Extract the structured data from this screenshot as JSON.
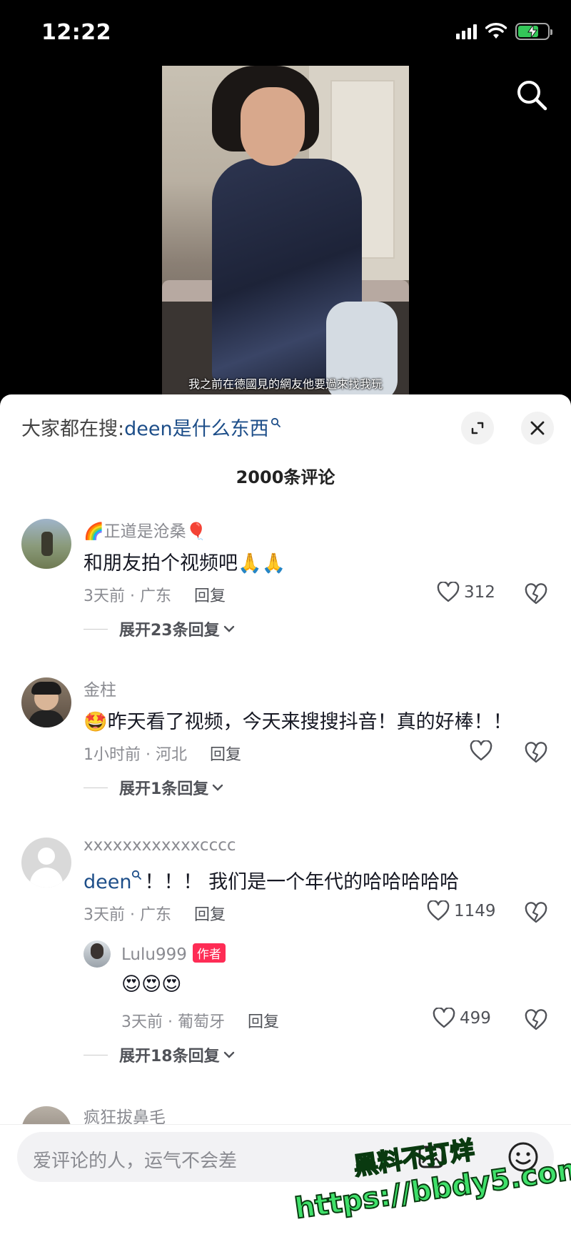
{
  "status": {
    "time": "12:22"
  },
  "video": {
    "subtitle": "我之前在德國見的網友他要過來找我玩"
  },
  "sheet": {
    "hot_search_prefix": "大家都在搜:",
    "hot_search_keyword": "deen是什么东西",
    "comment_count": "2000条评论"
  },
  "comments": [
    {
      "username": "🌈正道是沧桑🎈",
      "text": "和朋友拍个视频吧🙏🙏",
      "meta": "3天前 · 广东",
      "reply": "回复",
      "likes": "312",
      "expand": "展开23条回复"
    },
    {
      "username": "金柱",
      "text": "🤩昨天看了视频，今天来搜搜抖音！真的好棒！！",
      "meta": "1小时前 · 河北",
      "reply": "回复",
      "likes": "",
      "expand": "展开1条回复"
    },
    {
      "username": "xxxxxxxxxxxxcccc",
      "mention": "deen",
      "text": "！！！ 我们是一个年代的哈哈哈哈哈",
      "meta": "3天前 · 广东",
      "reply": "回复",
      "likes": "1149",
      "sub_reply": {
        "username": "Lulu999",
        "badge": "作者",
        "text": "😍😍😍",
        "meta": "3天前 · 葡萄牙",
        "reply": "回复",
        "likes": "499"
      },
      "expand": "展开18条回复"
    },
    {
      "username": "疯狂拔鼻毛"
    }
  ],
  "input": {
    "placeholder": "爱评论的人，运气不会差"
  },
  "watermark": {
    "line1": "黑料不打烊",
    "line2": "https://bbdy5.com"
  },
  "colors": {
    "accent": "#fe2c55",
    "link": "#1d4e89",
    "battery": "#34c759",
    "watermark": "#3fe06a"
  }
}
